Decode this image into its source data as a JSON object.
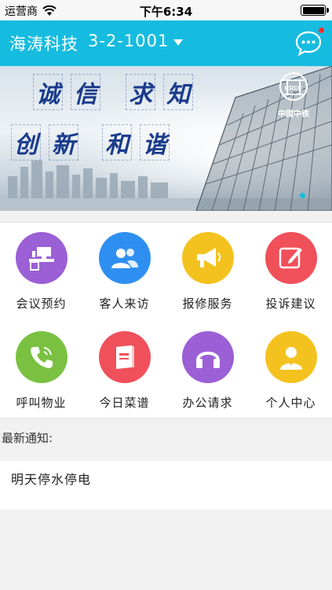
{
  "status_bar": {
    "carrier": "运营商",
    "time": "下午6:34"
  },
  "header": {
    "title": "海涛科技",
    "unit": "3-2-1001",
    "bg_color": "#16bce0"
  },
  "banner": {
    "slogan_row1": [
      "诚",
      "信",
      "求",
      "知"
    ],
    "slogan_row2": [
      "创",
      "新",
      "和",
      "谐"
    ],
    "logo_text": "中国中铁"
  },
  "menu": [
    {
      "label": "会议预约",
      "icon": "meeting-desk-icon",
      "color": "#9b5fd6"
    },
    {
      "label": "客人来访",
      "icon": "visitors-icon",
      "color": "#2f8ff0"
    },
    {
      "label": "报修服务",
      "icon": "megaphone-icon",
      "color": "#f4c21f"
    },
    {
      "label": "投诉建议",
      "icon": "edit-note-icon",
      "color": "#f0505a"
    },
    {
      "label": "呼叫物业",
      "icon": "phone-call-icon",
      "color": "#7ac142"
    },
    {
      "label": "今日菜谱",
      "icon": "menu-book-icon",
      "color": "#f0505a"
    },
    {
      "label": "办公请求",
      "icon": "headphones-icon",
      "color": "#9b5fd6"
    },
    {
      "label": "个人中心",
      "icon": "person-icon",
      "color": "#f4c21f"
    }
  ],
  "notice": {
    "heading": "最新通知:",
    "items": [
      "明天停水停电"
    ]
  }
}
